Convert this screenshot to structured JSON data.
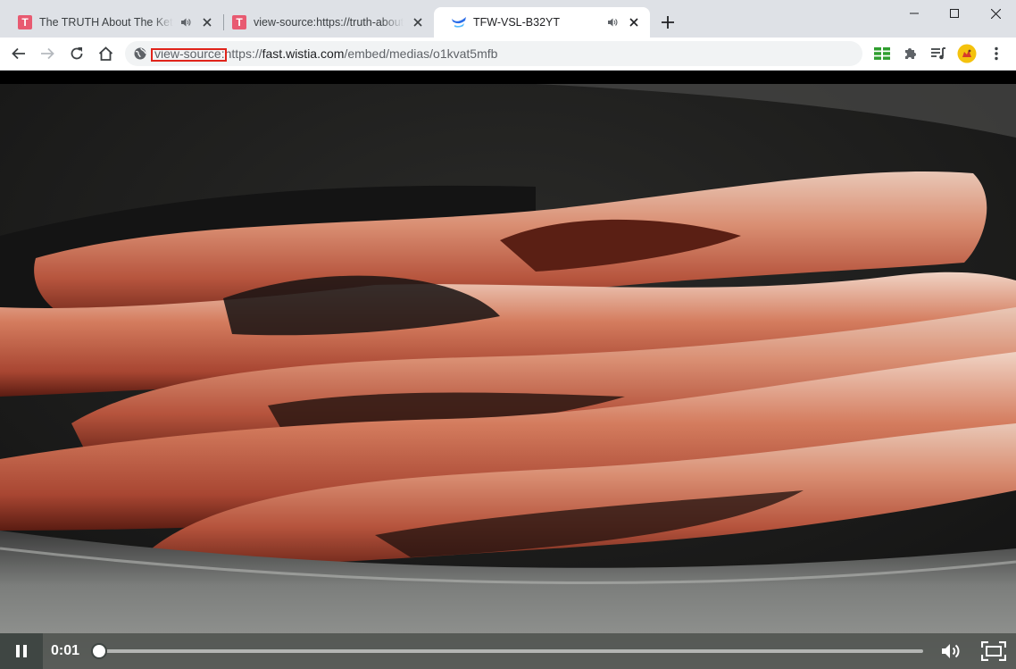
{
  "browser": {
    "tabs": [
      {
        "title": "The TRUTH About The Ketog",
        "favicon": "T",
        "active": false,
        "audio": true
      },
      {
        "title": "view-source:https://truth-about-",
        "favicon": "T",
        "active": false,
        "audio": false
      },
      {
        "title": "TFW-VSL-B32YT",
        "favicon": "wistia-icon",
        "active": true,
        "audio": true
      }
    ],
    "address": {
      "scheme_prefix": "view-source:",
      "scheme": "https://",
      "host": "fast.wistia.com",
      "path": "/embed/medias/o1kvat5mfb"
    },
    "colors": {
      "tab_strip": "#dee1e6",
      "highlight_box": "#e0241b",
      "favicon_t": "#e85a71"
    }
  },
  "player": {
    "state": "playing",
    "time": "0:01",
    "progress": 0.005,
    "scene": "bacon frying in a pan"
  }
}
